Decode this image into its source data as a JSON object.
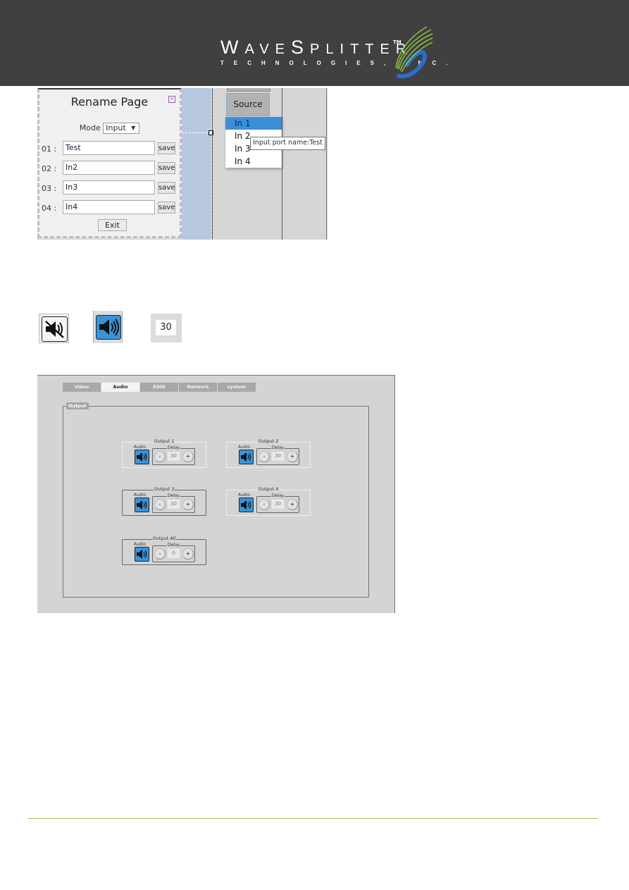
{
  "header": {
    "brand_main_parts": [
      "W",
      "AVE",
      "S",
      "PLITTER"
    ],
    "brand_sub": "TECHNOLOGIES, INC.",
    "trademark": "TM",
    "background_color": "#404040"
  },
  "rename_page": {
    "title": "Rename Page",
    "mode_label": "Mode",
    "mode_value": "Input",
    "rows": [
      {
        "index": "01 :",
        "value": "Test",
        "button": "save"
      },
      {
        "index": "02 :",
        "value": "In2",
        "button": "save"
      },
      {
        "index": "03 :",
        "value": "In3",
        "button": "save"
      },
      {
        "index": "04 :",
        "value": "In4",
        "button": "save"
      }
    ],
    "exit_label": "Exit"
  },
  "source_menu": {
    "button_label": "Source",
    "items": [
      "In 1",
      "In 2",
      "In 3",
      "In 4"
    ],
    "selected_index": 0,
    "tooltip": "Input port name:Test",
    "highlight_color": "#3a8fd9"
  },
  "icon_legend": {
    "mute_icon": "speaker-muted-icon",
    "unmute_icon": "speaker-on-icon",
    "delay_value": "30"
  },
  "audio_settings": {
    "tabs": [
      {
        "label": "Video",
        "active": false
      },
      {
        "label": "Audio",
        "active": true
      },
      {
        "label": "EDID",
        "active": false
      },
      {
        "label": "Network",
        "active": false
      },
      {
        "label": "system",
        "active": false
      }
    ],
    "fieldset_label": "Output",
    "audio_label": "Audio",
    "delay_label": "Delay",
    "minus_label": "-",
    "plus_label": "+",
    "outputs": [
      {
        "title": "Output 1",
        "delay": "30"
      },
      {
        "title": "Output 2",
        "delay": "30"
      },
      {
        "title": "Output 3",
        "delay": "30"
      },
      {
        "title": "Output 4",
        "delay": "30"
      },
      {
        "title": "Output All",
        "delay": "0"
      }
    ],
    "accent_color": "#3a93d9"
  }
}
